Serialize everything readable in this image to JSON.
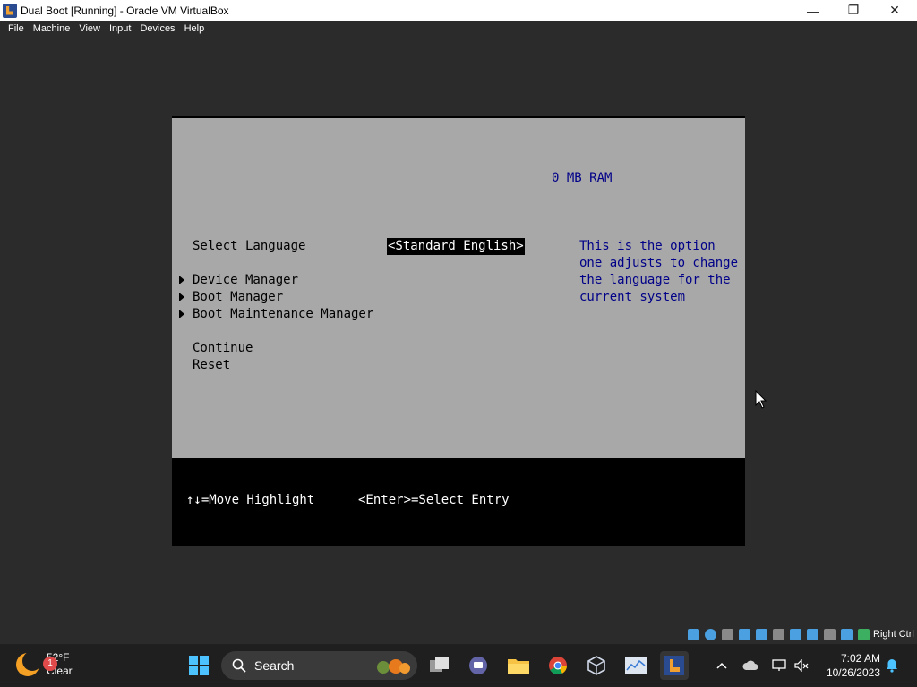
{
  "window": {
    "title": "Dual Boot [Running] - Oracle VM VirtualBox",
    "controls": {
      "minimize": "—",
      "maximize": "❐",
      "close": "✕"
    }
  },
  "menubar": {
    "items": [
      "File",
      "Machine",
      "View",
      "Input",
      "Devices",
      "Help"
    ]
  },
  "bios": {
    "ram": "0 MB RAM",
    "select_language_label": "Select Language",
    "select_language_value": "<Standard English>",
    "help_text": "This is the option\none adjusts to change\nthe language for the\ncurrent system",
    "menu": {
      "device_manager": "Device Manager",
      "boot_manager": "Boot Manager",
      "boot_maintenance_manager": "Boot Maintenance Manager"
    },
    "continue": "Continue",
    "reset": "Reset",
    "hint_move": "↑↓=Move Highlight",
    "hint_select": "<Enter>=Select Entry"
  },
  "vbox_status": {
    "host_key": "Right Ctrl"
  },
  "taskbar": {
    "weather": {
      "badge": "1",
      "temp": "52°F",
      "condition": "Clear"
    },
    "search_label": "Search",
    "clock": {
      "time": "7:02 AM",
      "date": "10/26/2023"
    }
  },
  "colors": {
    "bios_background": "#a8a8a8",
    "bios_accent_text": "#000088",
    "taskbar": "#1f1f1f"
  }
}
